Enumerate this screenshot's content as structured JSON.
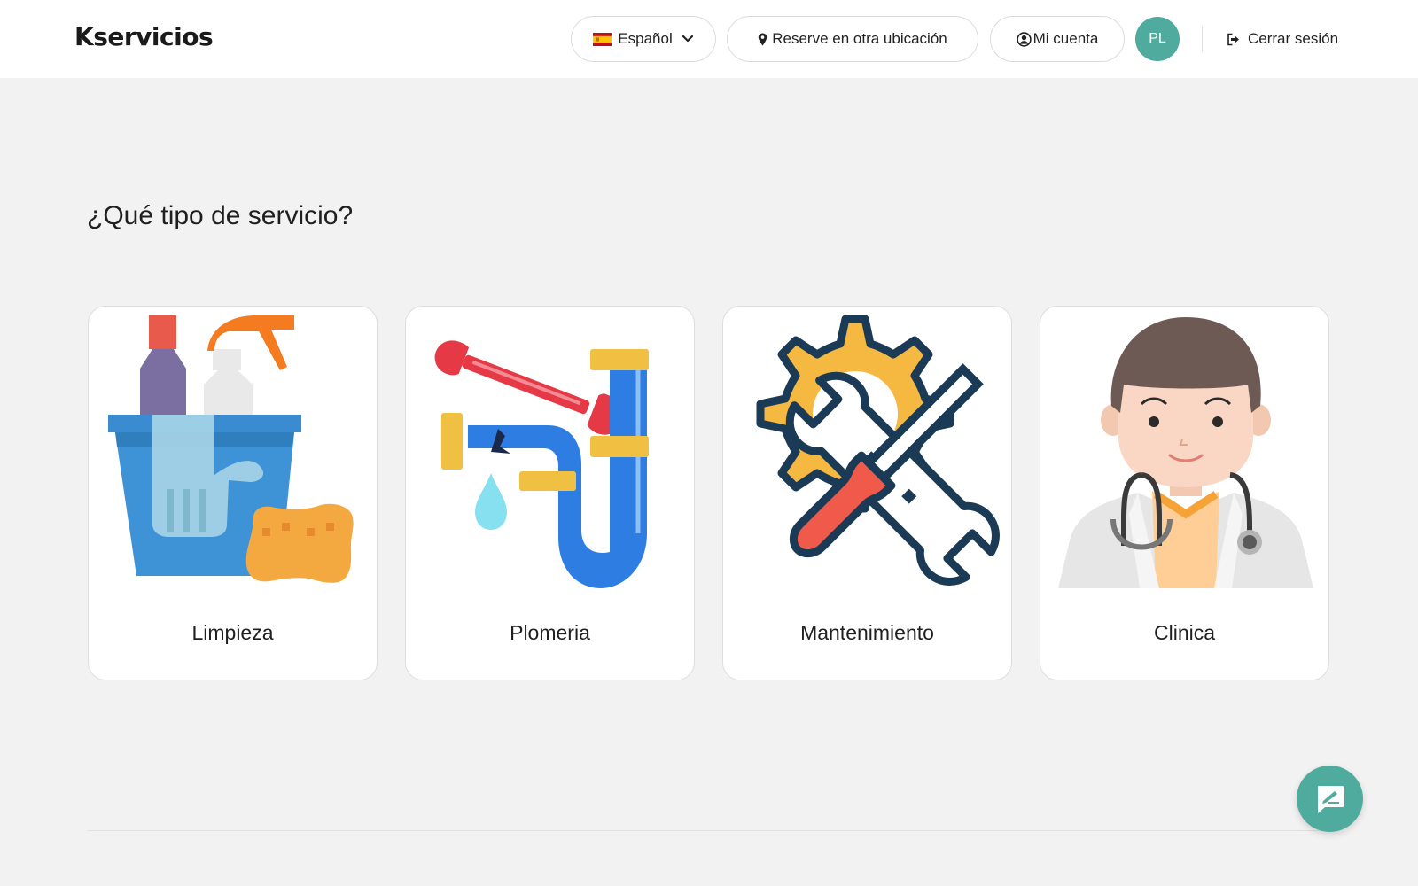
{
  "header": {
    "brand": "Kservicios",
    "language_label": "Español",
    "location_label": "Reserve en otra ubicación",
    "account_label": "Mi cuenta",
    "avatar_initials": "PL",
    "logout_label": "Cerrar sesión"
  },
  "main": {
    "heading": "¿Qué tipo de servicio?",
    "services": [
      {
        "label": "Limpieza",
        "icon": "cleaning-bucket-icon"
      },
      {
        "label": "Plomeria",
        "icon": "plumbing-pipe-icon"
      },
      {
        "label": "Mantenimiento",
        "icon": "tools-gear-icon"
      },
      {
        "label": "Clinica",
        "icon": "doctor-icon"
      }
    ]
  },
  "chat_fab": {
    "icon": "chat-compose-icon"
  },
  "colors": {
    "accent": "#4fab9e",
    "background": "#f2f2f2",
    "card": "#ffffff"
  }
}
